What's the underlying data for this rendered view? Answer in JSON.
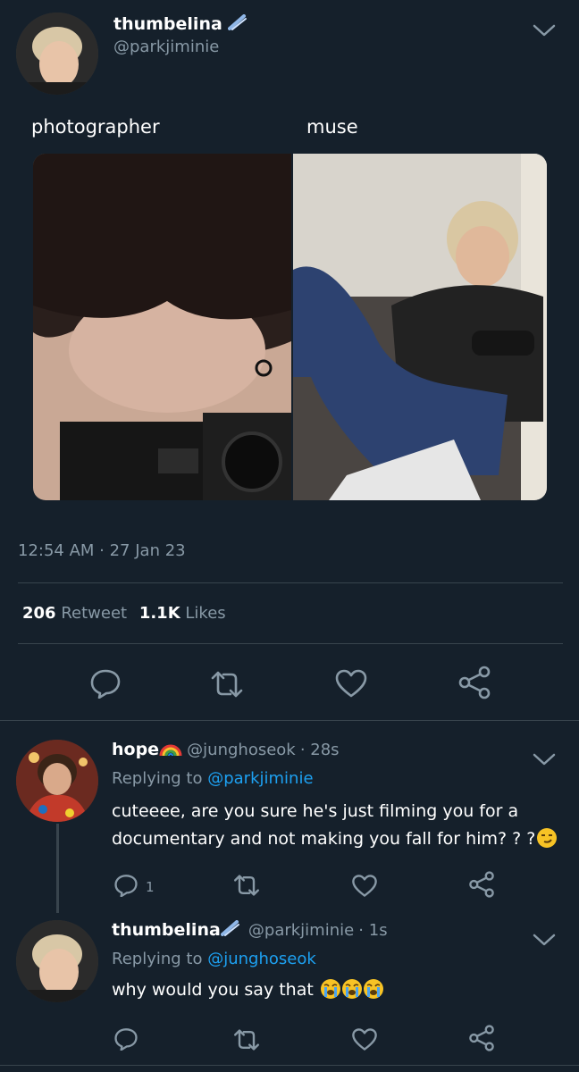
{
  "main_tweet": {
    "display_name": "thumbelina",
    "handle": "@parkjiminie",
    "caption_left": "photographer",
    "caption_right": "muse",
    "timestamp": "12:54 AM · 27 Jan 23",
    "retweet_count": "206",
    "retweet_label": "Retweet",
    "like_count": "1.1K",
    "like_label": "Likes"
  },
  "replies": [
    {
      "display_name": "hope",
      "handle": "@junghoseok",
      "time": "· 28s",
      "replying_prefix": "Replying to",
      "replying_to": "@parkjiminie",
      "text_line1": "cuteeee, are you sure he's just filming you for a",
      "text_line2": "documentary and not making you fall for him? ? ?",
      "reply_count": "1"
    },
    {
      "display_name": "thumbelina",
      "handle": "@parkjiminie",
      "time": "· 1s",
      "replying_prefix": "Replying to",
      "replying_to": "@junghoseok",
      "text": "why would you say that"
    }
  ],
  "colors": {
    "background": "#15202b",
    "accent": "#1da1f2",
    "muted": "#8899a6",
    "divider": "#38444d"
  }
}
